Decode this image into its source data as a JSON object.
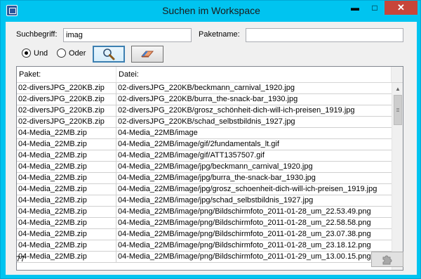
{
  "window": {
    "title": "Suchen im Workspace",
    "minimize_glyph": "▬",
    "maximize_glyph": "□",
    "close_glyph": "✕"
  },
  "search": {
    "term_label": "Suchbegriff:",
    "term_value": "imag",
    "package_label": "Paketname:",
    "package_value": "",
    "mode_and_label": "Und",
    "mode_or_label": "Oder",
    "selected_mode": "Und",
    "search_button_icon": "magnifier-icon",
    "clear_button_icon": "eraser-icon"
  },
  "table": {
    "columns": [
      "Paket:",
      "Datei:"
    ],
    "rows": [
      {
        "paket": "02-diversJPG_220KB.zip",
        "datei": "02-diversJPG_220KB/beckmann_carnival_1920.jpg"
      },
      {
        "paket": "02-diversJPG_220KB.zip",
        "datei": "02-diversJPG_220KB/burra_the-snack-bar_1930.jpg"
      },
      {
        "paket": "02-diversJPG_220KB.zip",
        "datei": "02-diversJPG_220KB/grosz_schönheit-dich-will-ich-preisen_1919.jpg"
      },
      {
        "paket": "02-diversJPG_220KB.zip",
        "datei": "02-diversJPG_220KB/schad_selbstbildnis_1927.jpg"
      },
      {
        "paket": "04-Media_22MB.zip",
        "datei": "04-Media_22MB/image"
      },
      {
        "paket": "04-Media_22MB.zip",
        "datei": "04-Media_22MB/image/gif/2fundamentals_lt.gif"
      },
      {
        "paket": "04-Media_22MB.zip",
        "datei": "04-Media_22MB/image/gif/ATT1357507.gif"
      },
      {
        "paket": "04-Media_22MB.zip",
        "datei": "04-Media_22MB/image/jpg/beckmann_carnival_1920.jpg"
      },
      {
        "paket": "04-Media_22MB.zip",
        "datei": "04-Media_22MB/image/jpg/burra_the-snack-bar_1930.jpg"
      },
      {
        "paket": "04-Media_22MB.zip",
        "datei": "04-Media_22MB/image/jpg/grosz_schoenheit-dich-will-ich-preisen_1919.jpg"
      },
      {
        "paket": "04-Media_22MB.zip",
        "datei": "04-Media_22MB/image/jpg/schad_selbstbildnis_1927.jpg"
      },
      {
        "paket": "04-Media_22MB.zip",
        "datei": "04-Media_22MB/image/png/Bildschirmfoto_2011-01-28_um_22.53.49.png"
      },
      {
        "paket": "04-Media_22MB.zip",
        "datei": "04-Media_22MB/image/png/Bildschirmfoto_2011-01-28_um_22.58.58.png"
      },
      {
        "paket": "04-Media_22MB.zip",
        "datei": "04-Media_22MB/image/png/Bildschirmfoto_2011-01-28_um_23.07.38.png"
      },
      {
        "paket": "04-Media_22MB.zip",
        "datei": "04-Media_22MB/image/png/Bildschirmfoto_2011-01-28_um_23.18.12.png"
      },
      {
        "paket": "04-Media_22MB.zip",
        "datei": "04-Media_22MB/image/png/Bildschirmfoto_2011-01-29_um_13.00.15.png"
      }
    ]
  },
  "footer": {
    "count": "77",
    "action_icon": "puzzle-icon"
  }
}
